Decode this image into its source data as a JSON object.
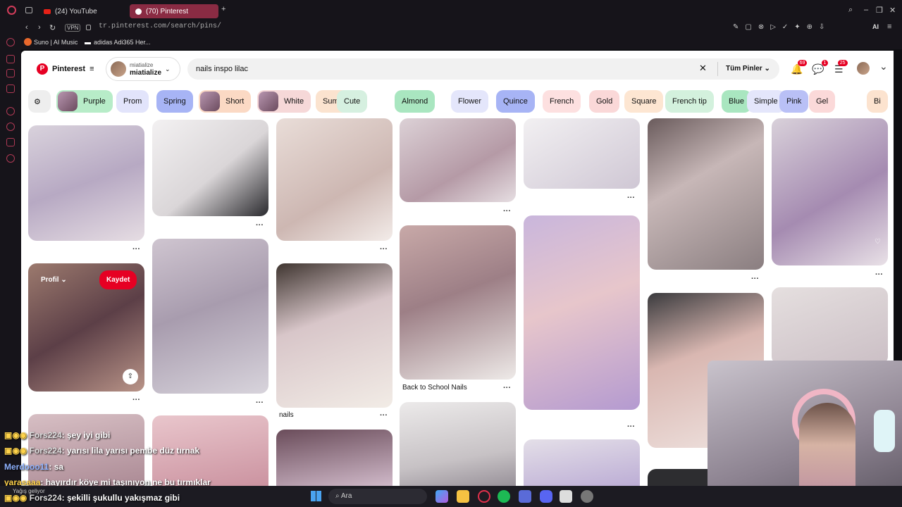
{
  "browser": {
    "tabs": [
      {
        "label": "(24) YouTube"
      },
      {
        "label": "(70) Pinterest"
      }
    ],
    "vpn": "VPN",
    "url": "tr.pinterest.com/search/pins/",
    "ai": "AI",
    "bookmarks": [
      {
        "label": "Suno | AI Music"
      },
      {
        "label": "adidas Adi365 Her..."
      }
    ]
  },
  "header": {
    "logo": "Pinterest",
    "account_top": "miatialize",
    "account_name": "miatialize",
    "search_value": "nails inspo lilac",
    "scope": "Tüm Pinler",
    "badges": {
      "notifications": "69",
      "messages": "1",
      "updates": "25"
    }
  },
  "chips": [
    {
      "label": "Purple",
      "color": "#b7ecc8",
      "thumb": true
    },
    {
      "label": "Prom",
      "color": "#e2e4fb"
    },
    {
      "label": "Spring",
      "color": "#a7b4f5"
    },
    {
      "label": "Short",
      "color": "#fbd9c4",
      "thumb": true
    },
    {
      "label": "White",
      "color": "#f6d8d8",
      "thumb": true
    },
    {
      "label": "Summer",
      "color": "#fbe3cf"
    },
    {
      "label": "Cute",
      "color": "#d6f0e0"
    },
    {
      "label": "Almond",
      "color": "#a9e6c0"
    },
    {
      "label": "Flower",
      "color": "#e4e6fb"
    },
    {
      "label": "Quince",
      "color": "#a7b4f5"
    },
    {
      "label": "French",
      "color": "#fde0e0"
    },
    {
      "label": "Gold",
      "color": "#fad8d8"
    },
    {
      "label": "Square",
      "color": "#fde6d2"
    },
    {
      "label": "French tip",
      "color": "#d3f1dd"
    },
    {
      "label": "Blue",
      "color": "#a9e6c0"
    },
    {
      "label": "Simple",
      "color": "#e4e6fb"
    },
    {
      "label": "Pink",
      "color": "#b9c0f6"
    },
    {
      "label": "Gel",
      "color": "#fbd9d9"
    },
    {
      "label": "Bi",
      "color": "#fce3cf"
    }
  ],
  "pins": {
    "hover_profile": "Profil",
    "save": "Kaydet",
    "titles": {
      "school": "Back to School Nails",
      "nails": "nails"
    }
  },
  "chat": [
    {
      "user": "Fors224",
      "msg": ": şey iyi gibi"
    },
    {
      "user": "Fors224",
      "msg": ": yarısı lila yarısı pembe düz tırnak"
    },
    {
      "user": "Merdooo11",
      "msg": ": sa"
    },
    {
      "user": "yarasaaa",
      "msg": ": hayırdır köye mi taşınıyon ne bu tırmıklar"
    },
    {
      "user": "Fors224",
      "msg": ": şekilli şukullu yakışmaz gibi"
    }
  ],
  "taskbar": {
    "search": "Ara",
    "notice": "Yağış geliyor"
  },
  "colors": {
    "accent": "#e60023",
    "tab_active": "#8a2b43"
  }
}
